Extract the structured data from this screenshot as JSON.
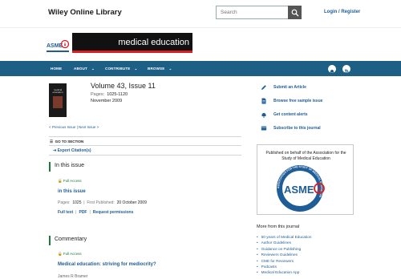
{
  "header": {
    "brand": "Wiley Online Library",
    "search_placeholder": "Search",
    "login": "Login / Register"
  },
  "banner": {
    "logo_text": "ASME",
    "journal_title": "medical education"
  },
  "nav": {
    "items": [
      "HOME",
      "ABOUT",
      "CONTRIBUTE",
      "BROWSE"
    ]
  },
  "issue": {
    "cover_title": "medical education",
    "title": "Volume 43, Issue 11",
    "pages_label": "Pages:",
    "pages": "1025-1120",
    "date": "November 2009",
    "prev_next": "< Previous Issue  |  Next Issue >"
  },
  "tools": {
    "goto": "GO TO SECTION",
    "export": "Export Citation(s)"
  },
  "sections": [
    {
      "heading": "In this issue",
      "access": "Full Access",
      "title": "in this issue",
      "pages_label": "Pages:",
      "pages": "1025",
      "published_label": "First Published:",
      "published": "20 October 2009",
      "links": [
        "Full text",
        "PDF",
        "Request permissions"
      ]
    },
    {
      "heading": "Commentary",
      "access": "Full Access",
      "title": "Medical education: striving for mediocrity?",
      "author": "James R Bramer"
    }
  ],
  "sidebar": {
    "actions": [
      "Submit an Article",
      "Browse free sample issue",
      "Get content alerts",
      "Subscribe to this journal"
    ],
    "society_text": "Published on behalf of the Association for the Study of Medical Education",
    "seal_text": "ASME",
    "seal_ring": "ASSOCIATION FOR THE STUDY OF MEDICAL EDUCATION",
    "more_title": "More from this journal",
    "more_items": [
      "50 years of Medical Education",
      "Author Guidelines",
      "Guidance on Publishing",
      "Reviewers Guidelines",
      "CME for Reviewers",
      "Podcasts",
      "Medical Education App"
    ]
  },
  "colors": {
    "nav": "#1e5f86",
    "link": "#1f5d96",
    "green": "#1c7a3a",
    "brand_red": "#d91f26"
  }
}
